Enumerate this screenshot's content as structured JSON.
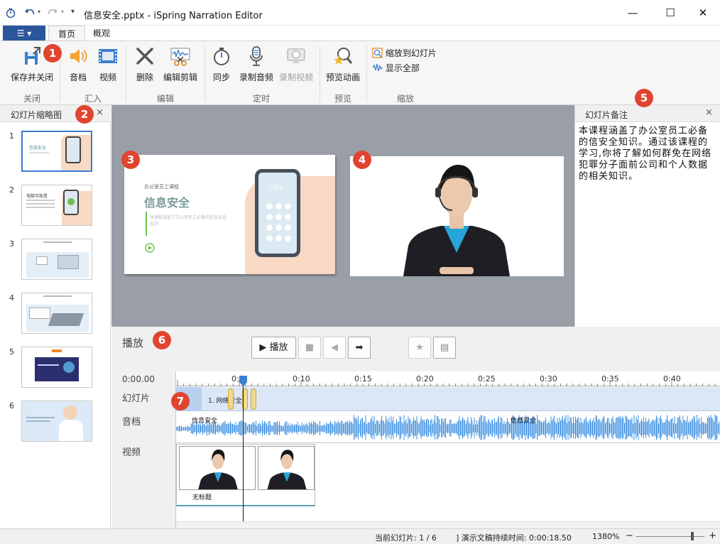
{
  "window": {
    "title": "信息安全.pptx - iSpring Narration Editor",
    "minimize": "—",
    "maximize": "☐",
    "close": "✕"
  },
  "ribbon_tabs": {
    "file_icon": "☰ ▾",
    "home": "首页",
    "overview": "概观"
  },
  "ribbon": {
    "save_close": "保存并关闭",
    "audio": "音档",
    "video": "视频",
    "delete": "删除",
    "edit_clip": "编辑剪辑",
    "sync": "同步",
    "record_audio": "录制音频",
    "record_video": "录制视频",
    "preview_anim": "预览动画",
    "zoom_to_slide": "缩放到幻灯片",
    "show_all": "显示全部",
    "groups": {
      "close": "关闭",
      "import": "汇入",
      "edit": "编辑",
      "timing": "定时",
      "preview": "预览",
      "zoom": "缩放"
    }
  },
  "badges": [
    "1",
    "2",
    "3",
    "4",
    "5",
    "6",
    "7"
  ],
  "thumbnails": {
    "title": "幻灯片缩略图",
    "close": "×",
    "items": [
      {
        "num": "1",
        "caption": "信息安全"
      },
      {
        "num": "2",
        "caption": "电脑可能是"
      },
      {
        "num": "3",
        "caption": ""
      },
      {
        "num": "4",
        "caption": ""
      },
      {
        "num": "5",
        "caption": ""
      },
      {
        "num": "6",
        "caption": ""
      }
    ]
  },
  "slide": {
    "subtitle": "办公室员工课程",
    "title": "信息安全",
    "body": "本课程涵盖了办公室员工必备的信息安全知识",
    "phone_label": "已锁定"
  },
  "notes": {
    "title": "幻灯片备注",
    "close": "×",
    "text": "本课程涵盖了办公室员工必备的信安全知识。通过该课程的学习,你将了解如何群免在网络犯罪分子面前公司和个人数据的相关知识。"
  },
  "playback": {
    "label": "播放",
    "play": "▶ 播放",
    "stop": "■",
    "prev": "◀",
    "next": "➡",
    "star": "★",
    "box": "▤"
  },
  "timeline": {
    "current_time": "0:00.00",
    "ticks": [
      "0:0",
      "0:10",
      "0:15",
      "0:20",
      "0:25",
      "0:30",
      "0:35",
      "0:40"
    ],
    "rows": {
      "slides": "幻灯片",
      "audio": "音档",
      "video": "视频"
    },
    "slide_clip": "1. 网络安全",
    "audio_clip1": "信息安全",
    "audio_clip2": "信息安全",
    "video_clip": "无标题"
  },
  "status": {
    "current_slide": "当前幻灯片: 1 / 6",
    "duration": "] 演示文稿持续时间: 0:00:18.50",
    "zoom": "1380%",
    "minus": "−",
    "plus": "+"
  },
  "colors": {
    "accent": "#2b579a",
    "badge": "#e0442f",
    "waveform": "#3d8fe0"
  }
}
